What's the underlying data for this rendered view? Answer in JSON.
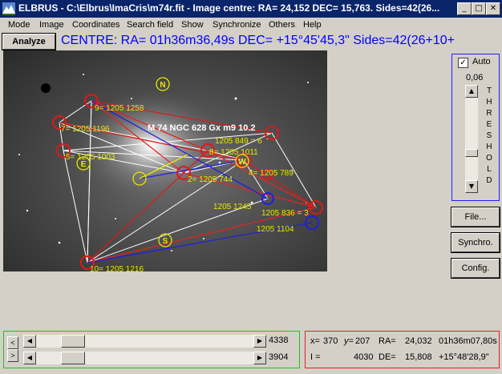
{
  "window": {
    "app_name": "ELBRUS",
    "title": "ELBRUS - C:\\Elbrus\\ImaCris\\m74r.fit - Image centre: RA= 24,152 DEC= 15,763. Sides=42(26...",
    "controls": {
      "minimize": "_",
      "maximize": "□",
      "close": "✕"
    }
  },
  "menu": [
    "Mode",
    "Image",
    "Coordinates",
    "Search field",
    "Show",
    "Synchronize",
    "Others",
    "Help"
  ],
  "toolbar": {
    "analyze_label": "Analyze",
    "centre_text": "CENTRE: RA= 01h36m36,49s   DEC= +15°45'45,3\"  Sides=42(26+10+"
  },
  "image": {
    "compass": {
      "north": "N",
      "east": "E",
      "west": "W",
      "south": "S"
    },
    "object_label": "M 74 NGC 628 Gx m9 10.2",
    "star_labels": [
      {
        "id": "s9",
        "text": "9= 1205 1258"
      },
      {
        "id": "s7",
        "text": "7= 1205 1196"
      },
      {
        "id": "s5",
        "text": "5= 1205 1003"
      },
      {
        "id": "s1",
        "text": "1205 849 = 6"
      },
      {
        "id": "s8",
        "text": "8= 1205 1011"
      },
      {
        "id": "s2",
        "text": "2= 1205 744"
      },
      {
        "id": "s4",
        "text": "4= 1205 789"
      },
      {
        "id": "s1245",
        "text": "1205 1245"
      },
      {
        "id": "s3",
        "text": "1205 836 = 3"
      },
      {
        "id": "s1104",
        "text": "1205 1104"
      },
      {
        "id": "s10",
        "text": "10= 1205 1216"
      }
    ]
  },
  "threshold": {
    "auto_label": "Auto",
    "auto_checked": true,
    "value": "0,06",
    "letters": [
      "T",
      "H",
      "R",
      "E",
      "S",
      "H",
      "O",
      "L",
      "D"
    ]
  },
  "buttons": {
    "file": "File...",
    "synchro": "Synchro.",
    "config": "Config."
  },
  "scroll": {
    "h1_value": "4338",
    "h2_value": "3904"
  },
  "status": {
    "x_label": "x=",
    "x_value": "370",
    "y_label": "y=",
    "y_value": "207",
    "ra_label": "RA=",
    "ra_deg": "24,032",
    "ra_hms": "01h36m07,80s",
    "i_label": "I =",
    "i_value": "4030",
    "de_label": "DE=",
    "de_deg": "15,808",
    "de_dms": "+15°48'28,9\""
  }
}
